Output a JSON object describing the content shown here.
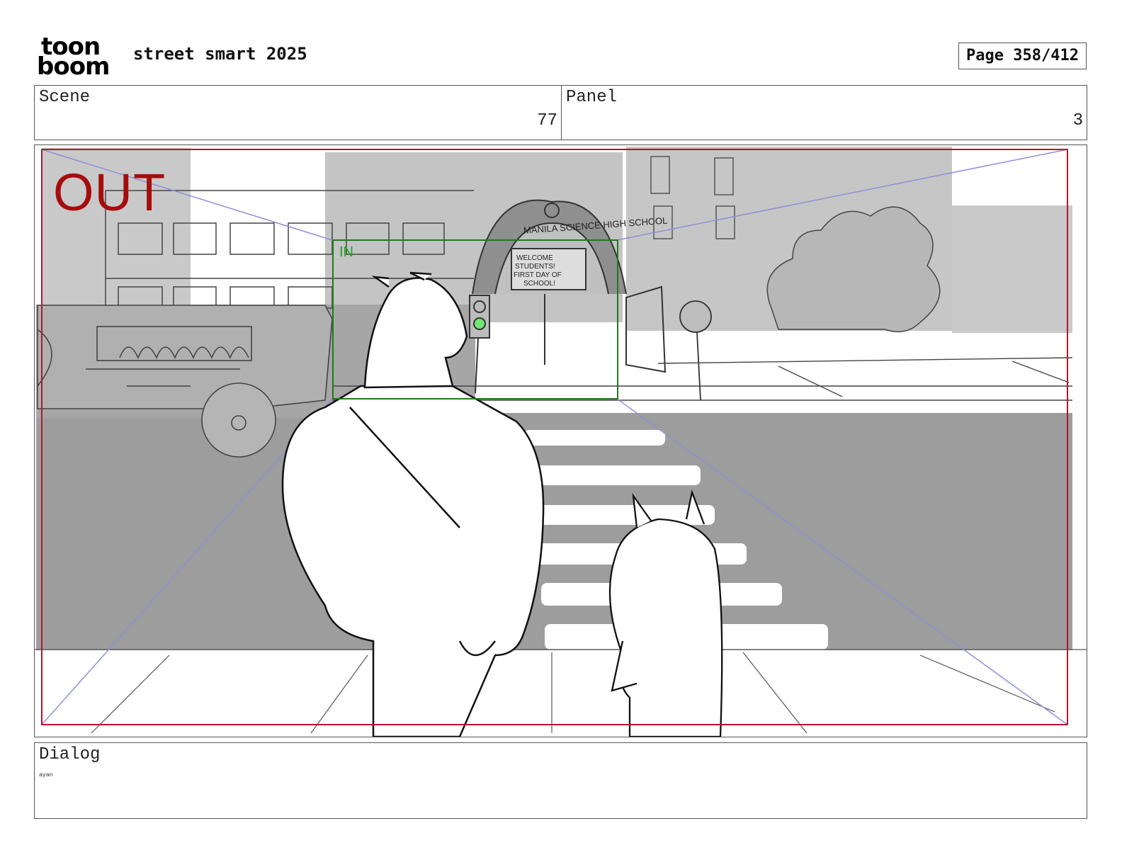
{
  "header": {
    "logo_line1": "toon",
    "logo_line2": "boom",
    "project_title": "street smart 2025",
    "page_label": "Page 358/412"
  },
  "scene": {
    "label": "Scene",
    "value": "77"
  },
  "panel": {
    "label": "Panel",
    "value": "3"
  },
  "artwork": {
    "out_label": "OUT",
    "in_label": "IN",
    "school_arch_text": "MANILA SCIENCE HIGH SCHOOL",
    "banner_line1": "WELCOME",
    "banner_line2": "STUDENTS!",
    "banner_line3": "FIRST DAY OF",
    "banner_line4": "SCHOOL!",
    "colors": {
      "out_frame": "#b5162b",
      "in_frame": "#1f7a1f",
      "perspective_lines": "#8f90d6",
      "background_gray": "#9b9b9b",
      "light_gray": "#c8c8c8"
    }
  },
  "dialog": {
    "label": "Dialog",
    "text": "ayan"
  }
}
